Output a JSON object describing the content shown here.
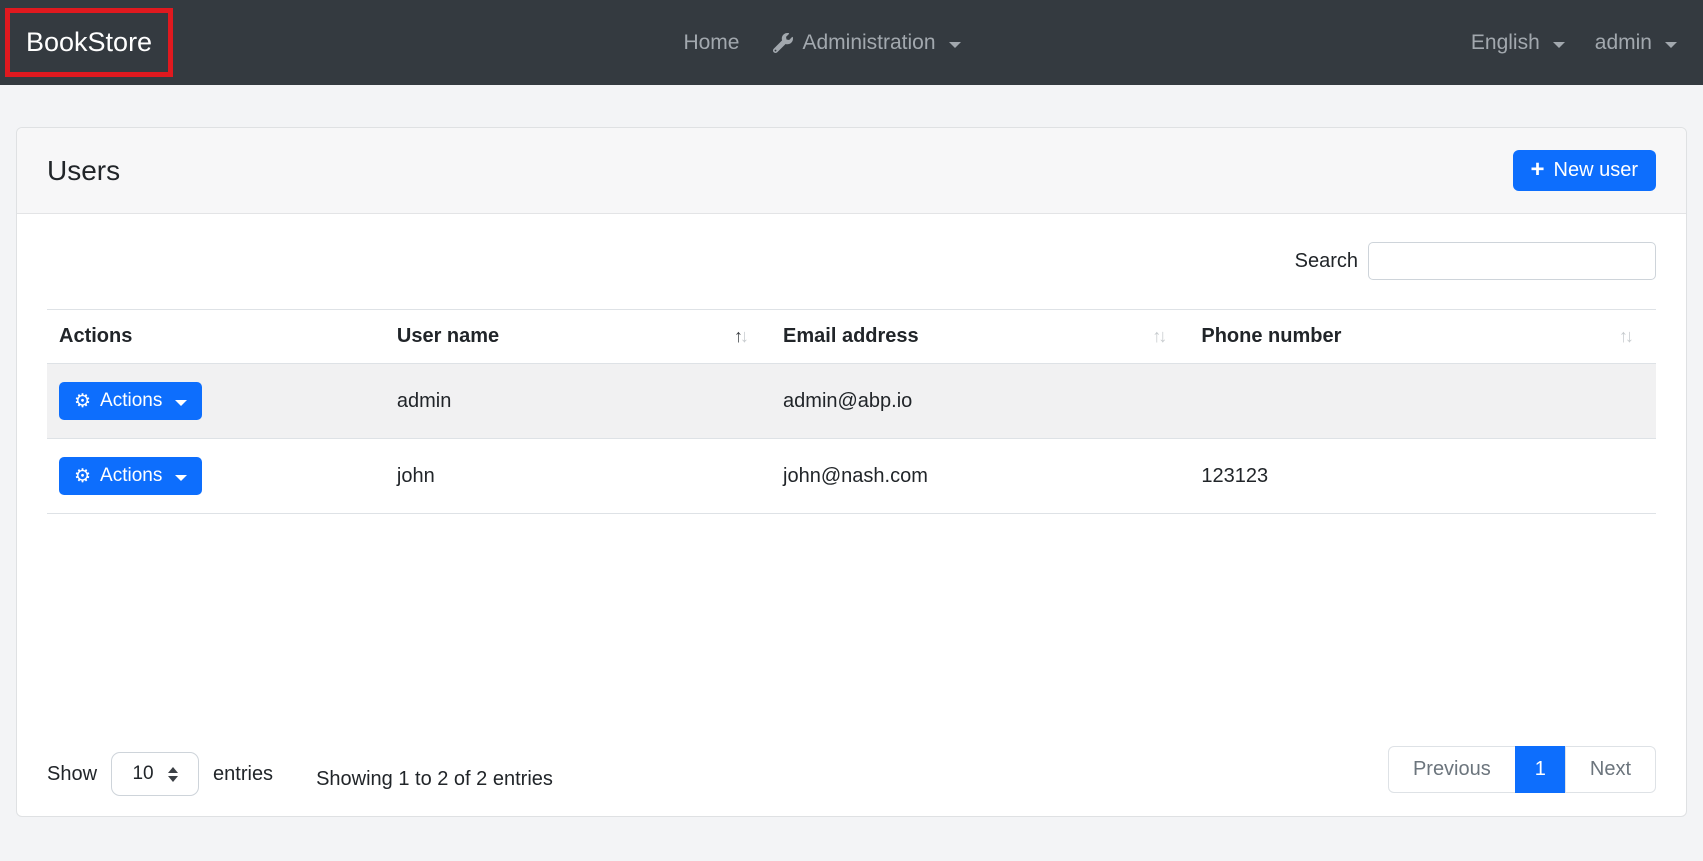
{
  "navbar": {
    "brand": "BookStore",
    "links": [
      {
        "label": "Home"
      },
      {
        "label": "Administration",
        "icon": "wrench"
      }
    ],
    "right": [
      {
        "label": "English"
      },
      {
        "label": "admin"
      }
    ]
  },
  "page": {
    "title": "Users",
    "new_user_label": "New user"
  },
  "search": {
    "label": "Search",
    "value": ""
  },
  "table": {
    "columns": [
      {
        "label": "Actions",
        "sortable": false
      },
      {
        "label": "User name",
        "sortable": true,
        "sorted": "asc"
      },
      {
        "label": "Email address",
        "sortable": true,
        "sorted": "none"
      },
      {
        "label": "Phone number",
        "sortable": true,
        "sorted": "none"
      }
    ],
    "rows": [
      {
        "actions_label": "Actions",
        "user_name": "admin",
        "email": "admin@abp.io",
        "phone": ""
      },
      {
        "actions_label": "Actions",
        "user_name": "john",
        "email": "john@nash.com",
        "phone": "123123"
      }
    ]
  },
  "footer": {
    "show_label": "Show",
    "page_size": "10",
    "entries_label": "entries",
    "summary": "Showing 1 to 2 of 2 entries",
    "pagination": {
      "previous": "Previous",
      "current": "1",
      "next": "Next"
    }
  },
  "icons": {
    "plus": "+",
    "gear": "⚙",
    "sort_up": "↑",
    "sort_down": "↓"
  },
  "colors": {
    "primary": "#0d6efd",
    "navbar_bg": "#343a40",
    "annotation_red": "#e0191f"
  }
}
